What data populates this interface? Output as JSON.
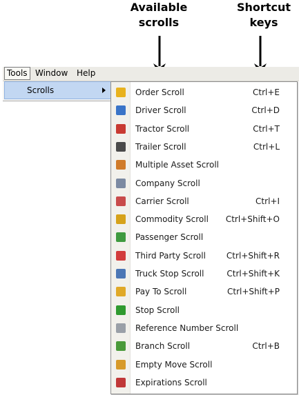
{
  "callouts": {
    "available": [
      "Available",
      "scrolls"
    ],
    "shortcut": [
      "Shortcut",
      "keys"
    ]
  },
  "menubar": {
    "tools": "Tools",
    "window": "Window",
    "help": "Help"
  },
  "tools_menu": {
    "scrolls": "Scrolls"
  },
  "scrolls": [
    {
      "label": "Order Scroll",
      "shortcut": "Ctrl+E",
      "icon": "order-icon",
      "color": "#e8b21e"
    },
    {
      "label": "Driver Scroll",
      "shortcut": "Ctrl+D",
      "icon": "driver-icon",
      "color": "#3a74c8"
    },
    {
      "label": "Tractor Scroll",
      "shortcut": "Ctrl+T",
      "icon": "tractor-icon",
      "color": "#c83a32"
    },
    {
      "label": "Trailer Scroll",
      "shortcut": "Ctrl+L",
      "icon": "trailer-icon",
      "color": "#4a4a4a"
    },
    {
      "label": "Multiple Asset Scroll",
      "shortcut": "",
      "icon": "multiple-asset-icon",
      "color": "#d07b2a"
    },
    {
      "label": "Company Scroll",
      "shortcut": "",
      "icon": "company-icon",
      "color": "#7c8aa2"
    },
    {
      "label": "Carrier Scroll",
      "shortcut": "Ctrl+I",
      "icon": "carrier-icon",
      "color": "#c84b4b"
    },
    {
      "label": "Commodity Scroll",
      "shortcut": "Ctrl+Shift+O",
      "icon": "commodity-icon",
      "color": "#d6a21a"
    },
    {
      "label": "Passenger Scroll",
      "shortcut": "",
      "icon": "passenger-icon",
      "color": "#3f9a3f"
    },
    {
      "label": "Third Party Scroll",
      "shortcut": "Ctrl+Shift+R",
      "icon": "third-party-icon",
      "color": "#d23c3c"
    },
    {
      "label": "Truck Stop Scroll",
      "shortcut": "Ctrl+Shift+K",
      "icon": "truck-stop-icon",
      "color": "#4c77b5"
    },
    {
      "label": "Pay To Scroll",
      "shortcut": "Ctrl+Shift+P",
      "icon": "pay-to-icon",
      "color": "#e0a928"
    },
    {
      "label": "Stop Scroll",
      "shortcut": "",
      "icon": "stop-icon",
      "color": "#2f9a2f"
    },
    {
      "label": "Reference Number Scroll",
      "shortcut": "",
      "icon": "reference-number-icon",
      "color": "#9aa0a8"
    },
    {
      "label": "Branch Scroll",
      "shortcut": "Ctrl+B",
      "icon": "branch-icon",
      "color": "#4a9a3a"
    },
    {
      "label": "Empty Move Scroll",
      "shortcut": "",
      "icon": "empty-move-icon",
      "color": "#d79a2a"
    },
    {
      "label": "Expirations Scroll",
      "shortcut": "",
      "icon": "expirations-icon",
      "color": "#c03838"
    }
  ]
}
